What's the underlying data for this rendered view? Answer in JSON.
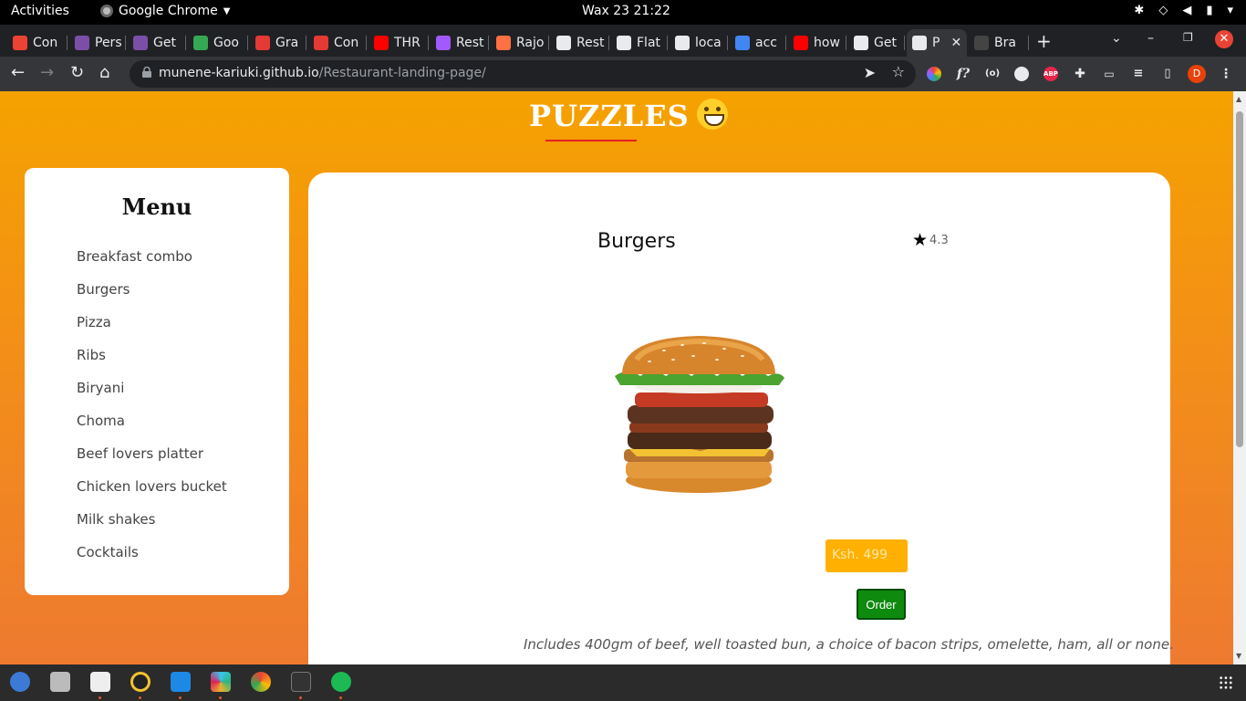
{
  "system_bar": {
    "activities": "Activities",
    "app_name": "Google Chrome",
    "clock": "Wax 23  21:22"
  },
  "browser": {
    "tabs": [
      {
        "label": "Con",
        "icon": "gmail-icon",
        "color": "#ea4335"
      },
      {
        "label": "Pers",
        "icon": "hackerrank-icon",
        "color": "#7b4fa8"
      },
      {
        "label": "Get",
        "icon": "hackerrank-icon",
        "color": "#7b4fa8"
      },
      {
        "label": "Goo",
        "icon": "drive-icon",
        "color": "#34a853"
      },
      {
        "label": "Gra",
        "icon": "circle-icon",
        "color": "#e53935"
      },
      {
        "label": "Con",
        "icon": "circle-icon",
        "color": "#e53935"
      },
      {
        "label": "THR",
        "icon": "youtube-icon",
        "color": "#ff0000"
      },
      {
        "label": "Rest",
        "icon": "figma-icon",
        "color": "#a259ff"
      },
      {
        "label": "Rajo",
        "icon": "multicolor-icon",
        "color": "#ff7043"
      },
      {
        "label": "Rest",
        "icon": "globe-icon",
        "color": "#e8eaed"
      },
      {
        "label": "Flat",
        "icon": "globe-icon",
        "color": "#e8eaed"
      },
      {
        "label": "loca",
        "icon": "face-icon",
        "color": "#e8eaed"
      },
      {
        "label": "acc",
        "icon": "google-icon",
        "color": "#4285f4"
      },
      {
        "label": "how",
        "icon": "youtube-icon",
        "color": "#ff0000"
      },
      {
        "label": "Get",
        "icon": "github-icon",
        "color": "#e8eaed"
      },
      {
        "label": "P",
        "icon": "globe-icon",
        "color": "#e8eaed",
        "active": true
      },
      {
        "label": "Bra",
        "icon": "github-icon",
        "color": "#444"
      }
    ],
    "url_domain": "munene-kariuki.github.io",
    "url_path": "/Restaurant-landing-page/",
    "profile_initial": "D",
    "ext_abp": "ABP"
  },
  "page": {
    "brand": "PUZZLES",
    "menu_title": "Menu",
    "menu_items": [
      "Breakfast combo",
      "Burgers",
      "Pizza",
      "Ribs",
      "Biryani",
      "Choma",
      "Beef lovers platter",
      "Chicken lovers bucket",
      "Milk shakes",
      "Cocktails"
    ],
    "item": {
      "title": "Burgers",
      "rating": "4.3",
      "price_placeholder": "Ksh. 499",
      "order_label": "Order",
      "description": "Includes 400gm of beef, well toasted bun, a choice of bacon strips, omelette, ham, all or none."
    }
  },
  "colors": {
    "accent_orange": "#f5a200",
    "order_green": "#0e8a0e",
    "price_yellow": "#ffb000",
    "brand_underline": "#e52020"
  }
}
